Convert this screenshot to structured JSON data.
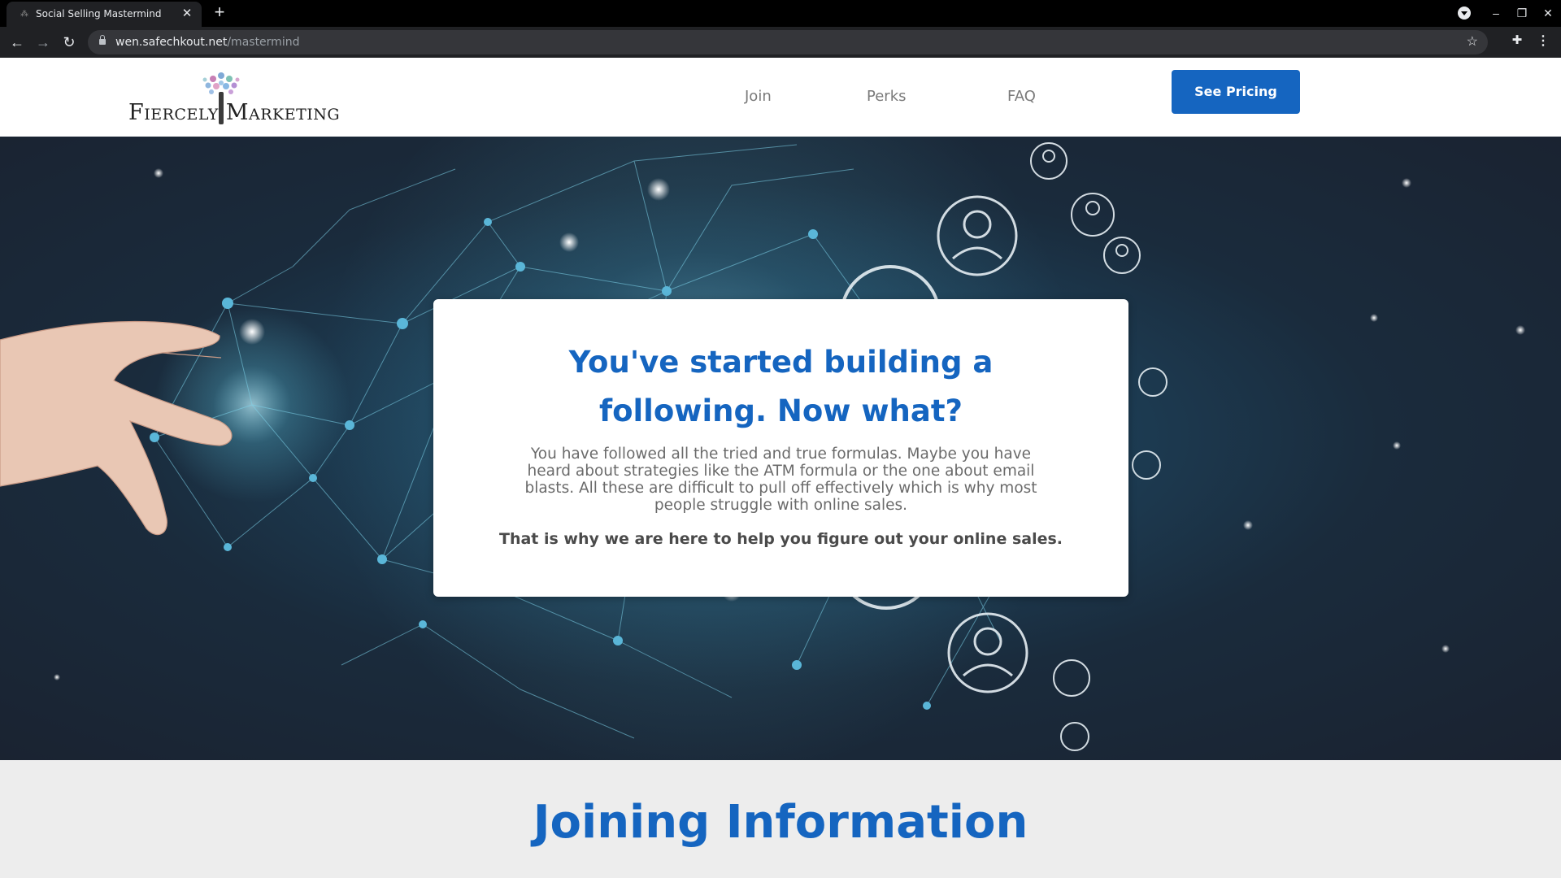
{
  "browser": {
    "tab_title": "Social Selling Mastermind",
    "tab_favicon": "tree-favicon-icon",
    "url_host": "wen.safechkout.net",
    "url_path": "/mastermind"
  },
  "header": {
    "logo_text": "Fiercely Marketing",
    "nav": [
      {
        "label": "Join"
      },
      {
        "label": "Perks"
      },
      {
        "label": "FAQ"
      }
    ],
    "cta_label": "See Pricing"
  },
  "hero": {
    "heading": "You've started building a following. Now what?",
    "body": "You have followed all the tried and true formulas. Maybe you have heard about strategies like the ATM formula or the one about email blasts. All these are difficult to pull off effectively which is why most people struggle with online sales.",
    "bold_line": "That is why we are here to help you figure out your online sales."
  },
  "joining": {
    "title": "Joining Information"
  },
  "colors": {
    "brand_blue": "#1565c0",
    "hero_dark": "#1a2230",
    "hero_glow": "#3f7f9c"
  }
}
